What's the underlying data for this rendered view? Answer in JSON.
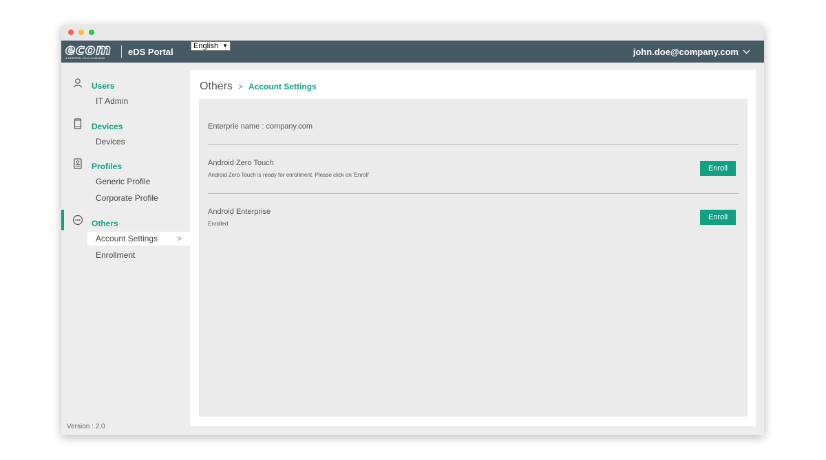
{
  "window": {
    "controls": [
      "close",
      "minimize",
      "maximize"
    ]
  },
  "header": {
    "logo_text": "ecom",
    "logo_subtext": "A PEPPERL+FUCHS BRAND",
    "portal_title": "eDS Portal",
    "language": {
      "selected": "English",
      "options": [
        "English"
      ]
    },
    "user_email": "john.doe@company.com"
  },
  "sidebar": {
    "sections": [
      {
        "icon": "user-icon",
        "label": "Users",
        "items": [
          {
            "label": "IT Admin"
          }
        ]
      },
      {
        "icon": "phone-icon",
        "label": "Devices",
        "items": [
          {
            "label": "Devices"
          }
        ]
      },
      {
        "icon": "id-card-icon",
        "label": "Profiles",
        "items": [
          {
            "label": "Generic Profile"
          },
          {
            "label": "Corporate Profile"
          }
        ]
      },
      {
        "icon": "more-circle-icon",
        "label": "Others",
        "items": [
          {
            "label": "Account Settings",
            "active": true
          },
          {
            "label": "Enrollment"
          }
        ]
      }
    ],
    "version": "Version : 2.0"
  },
  "breadcrumb": {
    "root": "Others",
    "separator": ">",
    "current": "Account Settings"
  },
  "settings": {
    "enterprise_name": "Enterprie name : company.com",
    "rows": [
      {
        "title": "Android Zero Touch",
        "description": "Android Zero Touch is ready for enrollment. Please click on 'Enroll'",
        "button": "Enroll"
      },
      {
        "title": "Android Enterprise",
        "description": "Enrolled",
        "button": "Enroll"
      }
    ]
  },
  "colors": {
    "accent": "#12a085",
    "header_bg": "#455a64",
    "sidebar_bg": "#ededed",
    "panel_bg": "#ebebeb"
  }
}
